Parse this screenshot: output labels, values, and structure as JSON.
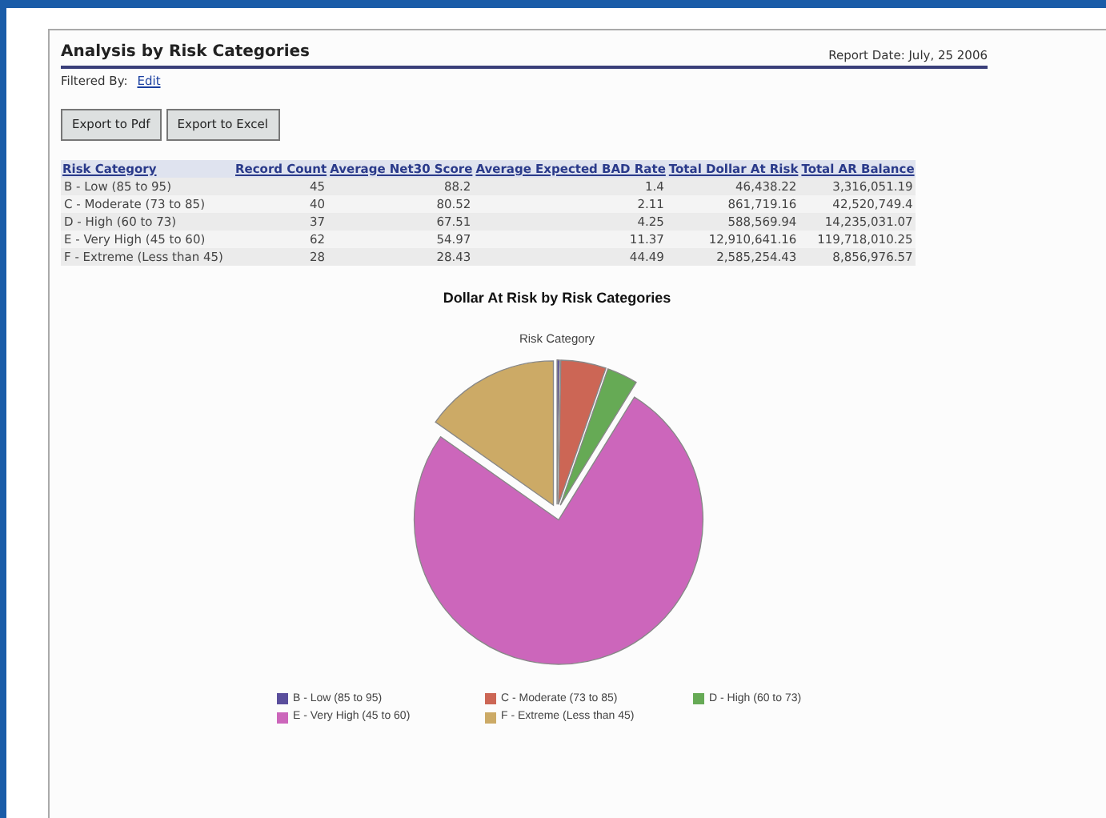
{
  "report": {
    "title": "Analysis by Risk Categories",
    "report_date": "Report Date: July, 25 2006",
    "filter_label": "Filtered By:",
    "filter_link": "Edit"
  },
  "buttons": [
    "Export to Pdf",
    "Export to Excel"
  ],
  "table": {
    "columns": [
      "Risk Category",
      "Record Count",
      "Average Net30 Score",
      "Average Expected BAD Rate",
      "Total Dollar At Risk",
      "Total AR Balance"
    ],
    "rows": [
      [
        "B - Low (85 to 95)",
        "45",
        "88.2",
        "1.4",
        "46,438.22",
        "3,316,051.19"
      ],
      [
        "C - Moderate (73 to 85)",
        "40",
        "80.52",
        "2.11",
        "861,719.16",
        "42,520,749.4"
      ],
      [
        "D - High (60 to 73)",
        "37",
        "67.51",
        "4.25",
        "588,569.94",
        "14,235,031.07"
      ],
      [
        "E - Very High (45 to 60)",
        "62",
        "54.97",
        "11.37",
        "12,910,641.16",
        "119,718,010.25"
      ],
      [
        "F - Extreme (Less than 45)",
        "28",
        "28.43",
        "44.49",
        "2,585,254.43",
        "8,856,976.57"
      ]
    ]
  },
  "chart": {
    "chart_data": {
      "type": "pie",
      "title": "Dollar At Risk by Risk Categories",
      "xlabel": "Risk Category",
      "categories": [
        "B - Low (85 to 95)",
        "C - Moderate (73 to 85)",
        "D - High (60 to 73)",
        "E - Very High (45 to 60)",
        "F - Extreme (Less than 45)"
      ],
      "legend": "bottom",
      "series": [
        {
          "colors": [
            "#5a4e9c",
            "#cc6655",
            "#66aa55",
            "#cc66bb",
            "#ccaa66"
          ],
          "values": [
            0.27,
            5.07,
            3.46,
            75.98,
            15.22
          ]
        }
      ]
    }
  }
}
